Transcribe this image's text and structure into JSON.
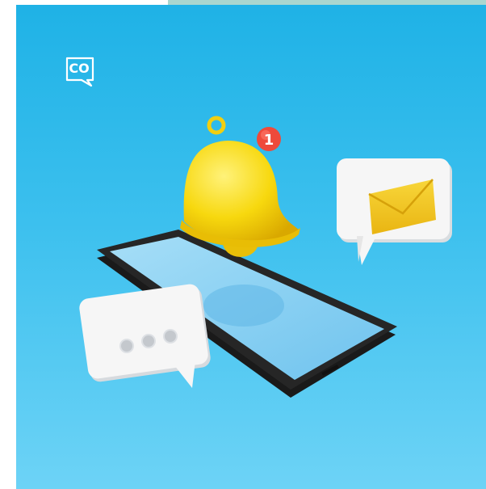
{
  "logo": {
    "text": "CO",
    "icon": "chat-bubble-logo"
  },
  "badge": {
    "count": "1"
  },
  "colors": {
    "background": "#2cb8ea",
    "bell": "#f8d90f",
    "badge": "#ee4a3b",
    "envelope": "#f2c31c",
    "bubble": "#f5f5f5",
    "phone_frame": "#1f1f1f",
    "phone_screen": "#8ed3f5"
  },
  "icons": [
    "bell-icon",
    "notification-badge",
    "envelope-icon",
    "message-bubble-icon",
    "typing-dots-icon",
    "smartphone-icon"
  ]
}
